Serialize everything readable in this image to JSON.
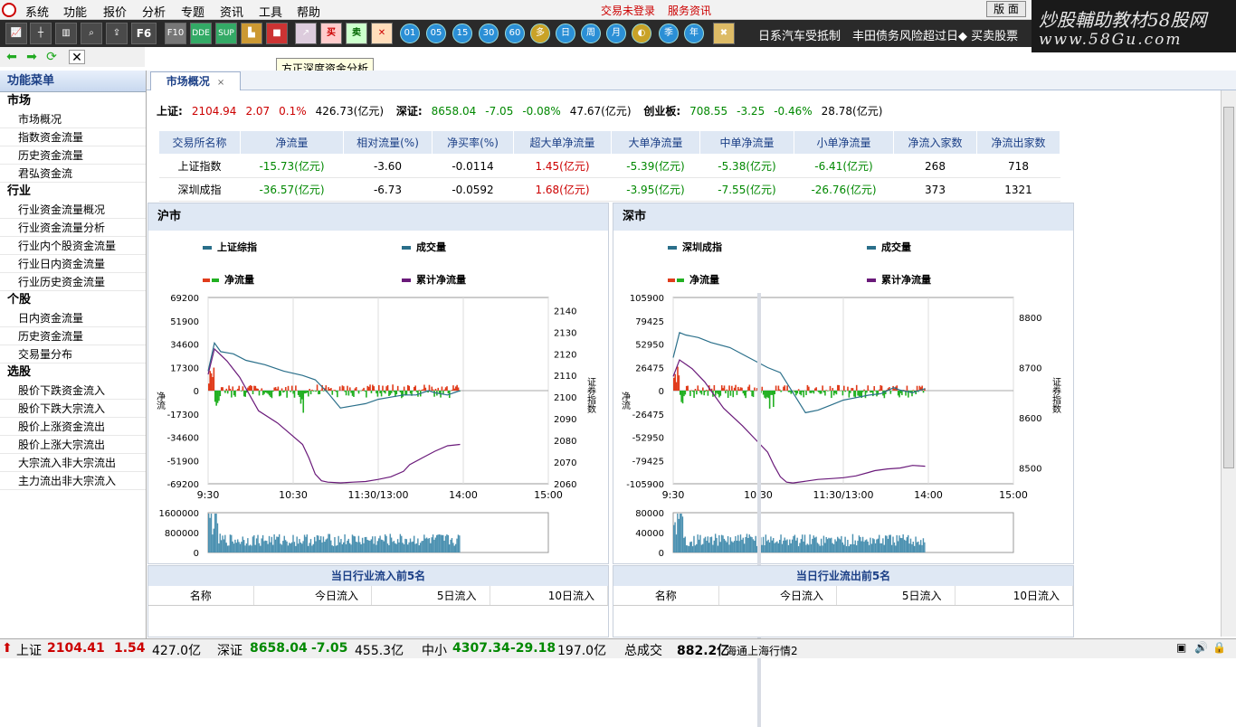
{
  "menu": {
    "items": [
      "系统",
      "功能",
      "报价",
      "分析",
      "专题",
      "资讯",
      "工具",
      "帮助"
    ],
    "links": [
      "交易未登录",
      "服务资讯"
    ],
    "version_label": "版 面"
  },
  "toolbar": {
    "buttons": [
      "F6"
    ],
    "circles": [
      "01",
      "05",
      "15",
      "30",
      "60",
      "日",
      "周",
      "月",
      "季",
      "年"
    ],
    "trade_buttons": [
      "买",
      "卖"
    ],
    "ticker": "日系汽车受抵制　丰田债务风险超过日◆ 买卖股票"
  },
  "brand": {
    "line1": "炒股輔助教材58股网",
    "line2": "www.58Gu.com"
  },
  "tooltip": "方正深度资金分析",
  "sidebar": {
    "header": "功能菜单",
    "sections": [
      {
        "title": "市场",
        "items": [
          "市场概况",
          "指数资金流量",
          "历史资金流量",
          "君弘资金流"
        ]
      },
      {
        "title": "行业",
        "items": [
          "行业资金流量概况",
          "行业资金流量分析",
          "行业内个股资金流量",
          "行业日内资金流量",
          "行业历史资金流量"
        ]
      },
      {
        "title": "个股",
        "items": [
          "日内资金流量",
          "历史资金流量",
          "交易量分布"
        ]
      },
      {
        "title": "选股",
        "items": [
          "股价下跌资金流入",
          "股价下跌大宗流入",
          "股价上涨资金流出",
          "股价上涨大宗流出",
          "大宗流入非大宗流出",
          "主力流出非大宗流入"
        ]
      }
    ]
  },
  "tab": {
    "label": "市场概况",
    "close": "×"
  },
  "summary": {
    "sh_label": "上证:",
    "sh_value": "2104.94",
    "sh_change": "2.07",
    "sh_pct": "0.1%",
    "sh_amount": "426.73(亿元)",
    "sz_label": "深证:",
    "sz_value": "8658.04",
    "sz_change": "-7.05",
    "sz_pct": "-0.08%",
    "sz_amount": "47.67(亿元)",
    "cy_label": "创业板:",
    "cy_value": "708.55",
    "cy_change": "-3.25",
    "cy_pct": "-0.46%",
    "cy_amount": "28.78(亿元)"
  },
  "flow_table": {
    "headers": [
      "交易所名称",
      "净流量",
      "相对流量(%)",
      "净买率(%)",
      "超大单净流量",
      "大单净流量",
      "中单净流量",
      "小单净流量",
      "净流入家数",
      "净流出家数"
    ],
    "rows": [
      [
        "上证指数",
        "-15.73(亿元)",
        "-3.60",
        "-0.0114",
        "1.45(亿元)",
        "-5.39(亿元)",
        "-5.38(亿元)",
        "-6.41(亿元)",
        "268",
        "718"
      ],
      [
        "深圳成指",
        "-36.57(亿元)",
        "-6.73",
        "-0.0592",
        "1.68(亿元)",
        "-3.95(亿元)",
        "-7.55(亿元)",
        "-26.76(亿元)",
        "373",
        "1321"
      ]
    ]
  },
  "panels": {
    "left_title": "沪市",
    "right_title": "深市",
    "left_legend": [
      "上证综指",
      "成交量",
      "净流量",
      "累计净流量"
    ],
    "right_legend": [
      "深圳成指",
      "成交量",
      "净流量",
      "累计净流量"
    ],
    "left_ylabel": "净流",
    "left_y2label": "证券指数",
    "right_ylabel": "净流",
    "right_y2label": "证券指数"
  },
  "industry": {
    "inflow_title": "当日行业流入前5名",
    "outflow_title": "当日行业流出前5名",
    "columns": [
      "名称",
      "今日流入",
      "5日流入",
      "10日流入"
    ]
  },
  "status": {
    "sh_label": "上证",
    "sh_value": "2104.41",
    "sh_change": "1.54",
    "sh_amount": "427.0亿",
    "sz_label": "深证",
    "sz_value": "8658.04",
    "sz_change": "-7.05",
    "sz_amount": "455.3亿",
    "zx_label": "中小",
    "zx_value": "4307.34",
    "zx_change": "-29.18",
    "zx_amount": "197.0亿",
    "total_label": "总成交",
    "total_value": "882.2亿",
    "info": "海通上海行情2"
  },
  "colors": {
    "index_line": "#2a6f8a",
    "net_in": "#e03c1c",
    "net_out": "#22b022",
    "cum_flow": "#6a1a7a",
    "volume": "#4a90b0"
  },
  "chart_data": [
    {
      "type": "line",
      "title": "沪市",
      "x_ticks": [
        "9:30",
        "10:30",
        "11:30/13:00",
        "14:00",
        "15:00"
      ],
      "y_ticks": [
        69200,
        51900,
        34600,
        17300,
        0,
        -17300,
        -34600,
        -51900,
        -69200
      ],
      "y2_ticks": [
        2140,
        2130,
        2120,
        2110,
        2100,
        2090,
        2080,
        2070,
        2060
      ],
      "y2_axis_label": "证券指数",
      "ylim": [
        -69200,
        69200
      ],
      "y2lim": [
        2060,
        2146
      ],
      "series": [
        {
          "name": "上证综指",
          "axis": "y2",
          "x": [
            0,
            5,
            10,
            20,
            30,
            45,
            60,
            75,
            85,
            95,
            105,
            115,
            125,
            135,
            145,
            155,
            165,
            175,
            180,
            190,
            200
          ],
          "values": [
            2112,
            2125,
            2121,
            2120,
            2117,
            2115,
            2112,
            2110,
            2108,
            2102,
            2095,
            2096,
            2097,
            2099,
            2100,
            2101,
            2101,
            2103,
            2102,
            2101,
            2103
          ]
        },
        {
          "name": "累计净流量",
          "axis": "y",
          "x": [
            0,
            5,
            15,
            25,
            40,
            55,
            65,
            75,
            80,
            85,
            90,
            95,
            105,
            115,
            125,
            135,
            145,
            155,
            160,
            170,
            180,
            190,
            200
          ],
          "values": [
            12000,
            31000,
            22000,
            10000,
            -15000,
            -24000,
            -32000,
            -40000,
            -50000,
            -62000,
            -67000,
            -68000,
            -68500,
            -68000,
            -67500,
            -66000,
            -64000,
            -60000,
            -55000,
            -50000,
            -45000,
            -41000,
            -40000
          ]
        }
      ],
      "net_flow_bars": {
        "x_range": [
          0,
          200
        ],
        "max_abs": 17000
      },
      "volume": {
        "ylim": [
          0,
          1600000
        ],
        "ticks": [
          1600000,
          800000,
          0
        ]
      }
    },
    {
      "type": "line",
      "title": "深市",
      "x_ticks": [
        "9:30",
        "10:30",
        "11:30/13:00",
        "14:00",
        "15:00"
      ],
      "y_ticks": [
        105900,
        79425,
        52950,
        26475,
        0,
        -26475,
        -52950,
        -79425,
        -105900
      ],
      "y2_ticks": [
        8800,
        8700,
        8600,
        8500
      ],
      "y2_axis_label": "证券指数",
      "ylim": [
        -105900,
        105900
      ],
      "y2lim": [
        8468,
        8840
      ],
      "series": [
        {
          "name": "深圳成指",
          "axis": "y2",
          "x": [
            0,
            5,
            10,
            20,
            30,
            45,
            60,
            75,
            85,
            95,
            105,
            115,
            125,
            135,
            145,
            155,
            165,
            175,
            180,
            190,
            200
          ],
          "values": [
            8720,
            8770,
            8765,
            8760,
            8750,
            8740,
            8720,
            8700,
            8690,
            8650,
            8610,
            8615,
            8625,
            8635,
            8640,
            8645,
            8648,
            8660,
            8655,
            8650,
            8658
          ]
        },
        {
          "name": "累计净流量",
          "axis": "y",
          "x": [
            0,
            5,
            15,
            25,
            40,
            55,
            65,
            75,
            80,
            85,
            90,
            95,
            105,
            115,
            125,
            135,
            145,
            155,
            160,
            170,
            180,
            190,
            200
          ],
          "values": [
            16000,
            35000,
            25000,
            10000,
            -20000,
            -40000,
            -55000,
            -70000,
            -85000,
            -98000,
            -104000,
            -105000,
            -103000,
            -101000,
            -100000,
            -99000,
            -97000,
            -93000,
            -91000,
            -89000,
            -88000,
            -85000,
            -86000
          ]
        }
      ],
      "net_flow_bars": {
        "x_range": [
          0,
          200
        ],
        "max_abs": 26000
      },
      "volume": {
        "ylim": [
          0,
          80000
        ],
        "ticks": [
          80000,
          40000,
          0
        ]
      }
    }
  ]
}
